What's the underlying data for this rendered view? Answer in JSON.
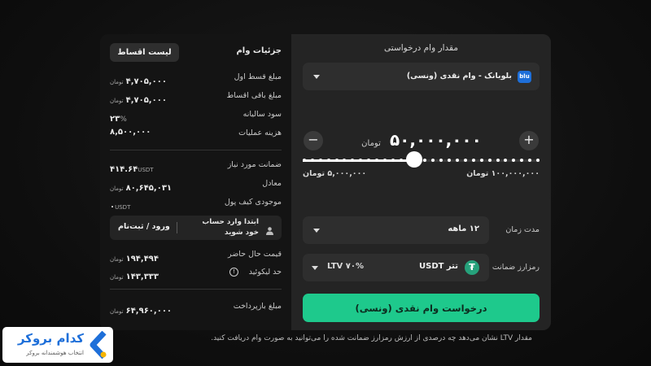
{
  "left_panel": {
    "title": "جزئیات وام",
    "installments_button": "لیست اقساط",
    "rows_top": [
      {
        "label": "مبلغ قسط اول",
        "value": "۴,۷۰۵,۰۰۰",
        "unit": "تومان"
      },
      {
        "label": "مبلغ باقی اقساط",
        "value": "۴,۷۰۵,۰۰۰",
        "unit": "تومان"
      },
      {
        "label": "سود سالیانه",
        "value": "۲۳",
        "unit": "%"
      },
      {
        "label": "هزینه عملیات",
        "value": "۸,۵۰۰,۰۰۰",
        "unit": ""
      }
    ],
    "rows_mid": [
      {
        "label": "ضمانت مورد نیاز",
        "value": "۴۱۴.۶۴",
        "unit": "USDT"
      },
      {
        "label": "معادل",
        "value": "۸۰,۶۴۵,۰۳۱",
        "unit": "تومان"
      },
      {
        "label": "موجودی کیف پول",
        "value": "۰",
        "unit": "USDT"
      }
    ],
    "login_notice": "ابتدا وارد حساب خود شوید",
    "login_button": "ورود / ثبت‌نام",
    "rows_bottom": [
      {
        "label": "قیمت حال حاضر",
        "value": "۱۹۴,۴۹۴",
        "unit": "تومان"
      },
      {
        "label": "حد لیکوئید",
        "value": "۱۴۳,۳۳۳",
        "unit": "تومان"
      }
    ],
    "repayment": {
      "label": "مبلغ بازپرداخت",
      "value": "۶۴,۹۶۰,۰۰۰",
      "unit": "تومان"
    }
  },
  "right_panel": {
    "title": "مقدار وام درخواستی",
    "provider_select": {
      "value": "بلوبانک - وام نقدی (ونسی)",
      "icon_text": "blu"
    },
    "amount": {
      "value": "۵۰,۰۰۰,۰۰۰",
      "unit": "تومان"
    },
    "slider": {
      "min_label": "۵,۰۰۰,۰۰۰ تومان",
      "max_label": "۱۰۰,۰۰۰,۰۰۰ تومان",
      "position_fraction": 0.47
    },
    "duration": {
      "label": "مدت زمان",
      "value": "۱۲ ماهه"
    },
    "collateral": {
      "label": "رمزارز ضمانت",
      "asset": "تتر USDT",
      "ltv": "LTV ۷۰%"
    },
    "submit_button": "درخواست وام نقدی (ونسی)"
  },
  "footnote": "مقدار LTV نشان می‌دهد چه درصدی از ارزش رمزارز ضمانت شده را می‌توانید به صورت وام دریافت کنید.",
  "brand": {
    "name": "کدام بروکر",
    "tagline": "انتخاب هوشمندانه بروکر"
  },
  "colors": {
    "accent": "#1ec98c",
    "tether": "#26a17b",
    "brand_blue": "#1e6fd9"
  }
}
